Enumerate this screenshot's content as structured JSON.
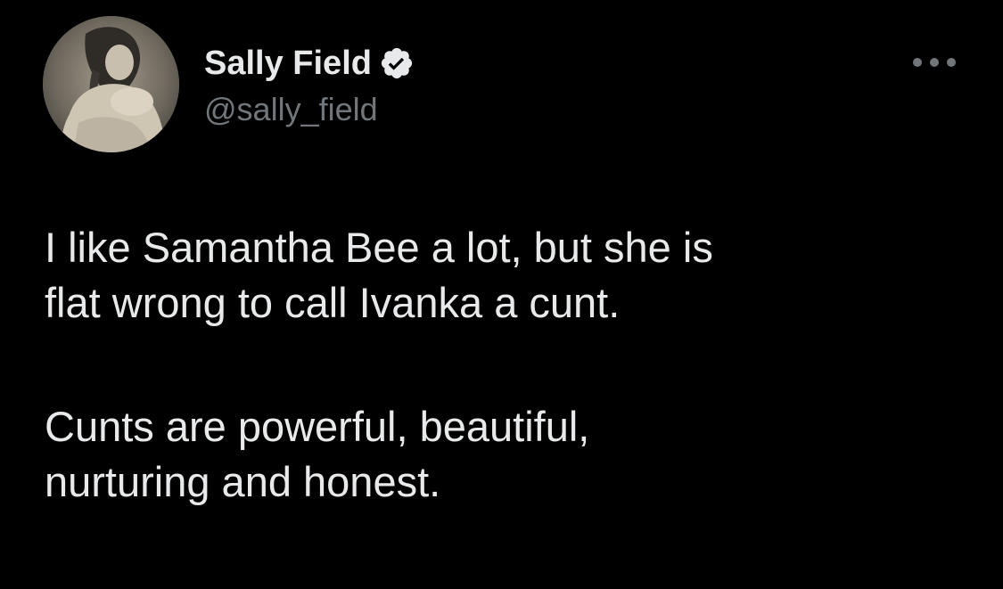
{
  "tweet": {
    "author": {
      "display_name": "Sally Field",
      "handle": "@sally_field",
      "verified": true,
      "avatar_icon": "profile-photo-avatar"
    },
    "more_icon": "more-options-icon",
    "text": {
      "paragraph1": {
        "line1": "I like Samantha Bee a lot, but she is",
        "line2": "flat wrong to call Ivanka a cunt."
      },
      "paragraph2": {
        "line1": "Cunts are powerful, beautiful,",
        "line2": "nurturing and honest."
      }
    }
  },
  "colors": {
    "background": "#000000",
    "primary_text": "#e7e9ea",
    "secondary_text": "#71767b",
    "verified_badge": "#e7e9ea"
  }
}
